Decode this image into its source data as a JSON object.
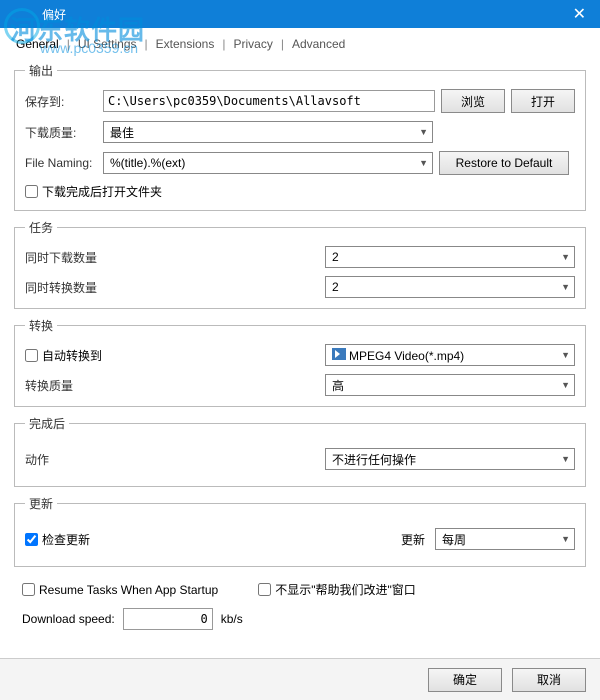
{
  "window": {
    "title": "偏好"
  },
  "watermark": {
    "text": "河东软件园",
    "url": "www.pc0359.cn"
  },
  "tabs": {
    "general": "General",
    "ui": "UI Settings",
    "extensions": "Extensions",
    "privacy": "Privacy",
    "advanced": "Advanced"
  },
  "output": {
    "legend": "输出",
    "save_to_label": "保存到:",
    "save_to_value": "C:\\Users\\pc0359\\Documents\\Allavsoft",
    "browse": "浏览",
    "open": "打开",
    "quality_label": "下载质量:",
    "quality_value": "最佳",
    "naming_label": "File Naming:",
    "naming_value": "%(title).%(ext)",
    "restore": "Restore to Default",
    "open_after_label": "下载完成后打开文件夹",
    "open_after_checked": false
  },
  "tasks": {
    "legend": "任务",
    "dl_count_label": "同时下载数量",
    "dl_count_value": "2",
    "cv_count_label": "同时转换数量",
    "cv_count_value": "2"
  },
  "convert": {
    "legend": "转换",
    "auto_label": "自动转换到",
    "auto_checked": false,
    "format_value": "MPEG4 Video(*.mp4)",
    "quality_label": "转换质量",
    "quality_value": "高"
  },
  "after": {
    "legend": "完成后",
    "action_label": "动作",
    "action_value": "不进行任何操作"
  },
  "update": {
    "legend": "更新",
    "check_label": "检查更新",
    "check_checked": true,
    "freq_label": "更新",
    "freq_value": "每周"
  },
  "misc": {
    "resume_label": "Resume Tasks When App Startup",
    "resume_checked": false,
    "hide_help_label": "不显示\"帮助我们改进\"窗口",
    "hide_help_checked": false,
    "speed_label": "Download speed:",
    "speed_value": "0",
    "speed_unit": "kb/s"
  },
  "footer": {
    "ok": "确定",
    "cancel": "取消"
  }
}
